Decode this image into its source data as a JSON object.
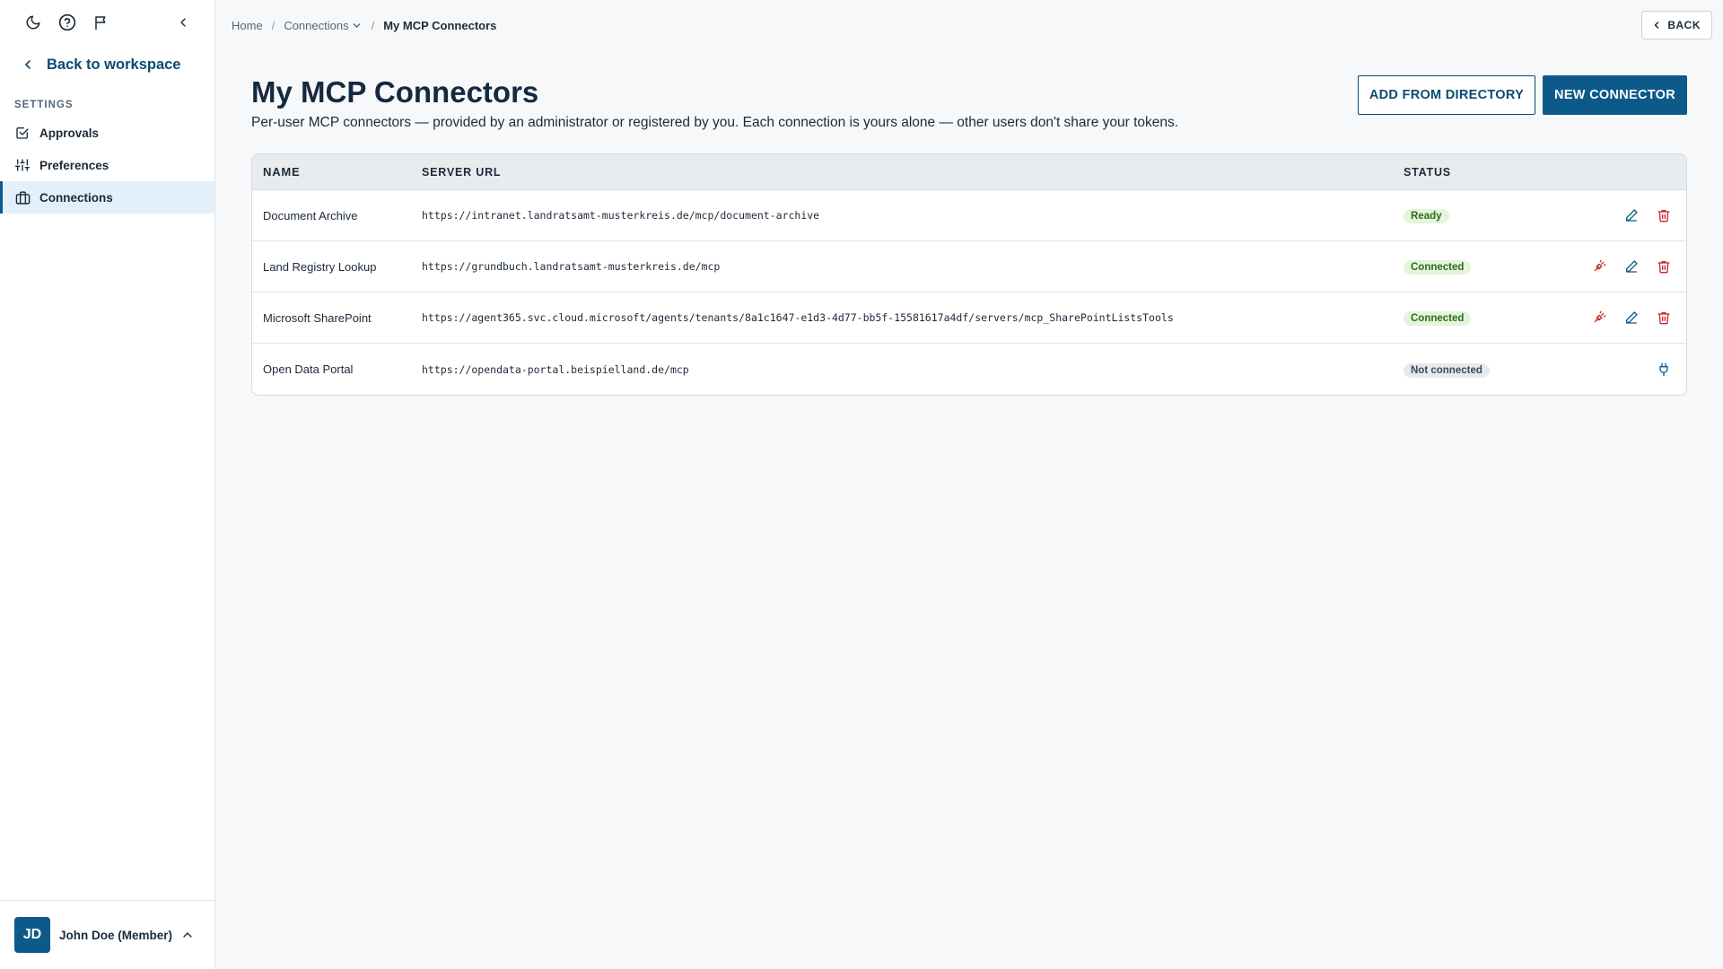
{
  "sidebar": {
    "back_label": "Back to workspace",
    "section_label": "SETTINGS",
    "items": [
      {
        "label": "Approvals"
      },
      {
        "label": "Preferences"
      },
      {
        "label": "Connections"
      }
    ],
    "user": {
      "initials": "JD",
      "name": "John Doe (Member)"
    }
  },
  "breadcrumb": {
    "home": "Home",
    "connections": "Connections",
    "current": "My MCP Connectors"
  },
  "header": {
    "back_label": "BACK",
    "title": "My MCP Connectors",
    "description": "Per-user MCP connectors — provided by an administrator or registered by you. Each connection is yours alone — other users don't share your tokens.",
    "add_from_directory": "ADD FROM DIRECTORY",
    "new_connector": "NEW CONNECTOR"
  },
  "table": {
    "columns": {
      "name": "NAME",
      "url": "SERVER URL",
      "status": "STATUS"
    },
    "rows": [
      {
        "name": "Document Archive",
        "url": "https://intranet.landratsamt-musterkreis.de/mcp/document-archive",
        "status": "Ready"
      },
      {
        "name": "Land Registry Lookup",
        "url": "https://grundbuch.landratsamt-musterkreis.de/mcp",
        "status": "Connected"
      },
      {
        "name": "Microsoft SharePoint",
        "url": "https://agent365.svc.cloud.microsoft/agents/tenants/8a1c1647-e1d3-4d77-bb5f-15581617a4df/servers/mcp_SharePointListsTools",
        "status": "Connected"
      },
      {
        "name": "Open Data Portal",
        "url": "https://opendata-portal.beispielland.de/mcp",
        "status": "Not connected"
      }
    ]
  },
  "colors": {
    "primary": "#0d5a8a",
    "danger": "#c62828",
    "ready_bg": "#e3f5dc"
  }
}
